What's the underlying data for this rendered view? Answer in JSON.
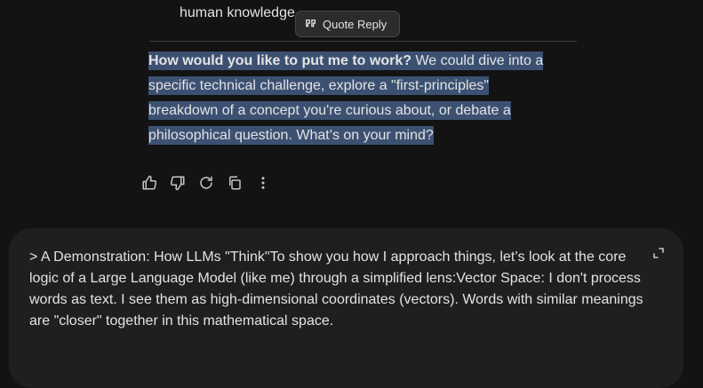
{
  "previous": {
    "line": "human knowledge"
  },
  "quote_reply": {
    "label": "Quote Reply"
  },
  "answer": {
    "bold": "How would you like to put me to work?",
    "rest": " We could dive into a specific technical challenge, explore a \"first-principles\" breakdown of a concept you're curious about, or debate a philosophical question. What’s on your mind?"
  },
  "actions": [
    "thumbs-up-icon",
    "thumbs-down-icon",
    "regenerate-icon",
    "copy-icon",
    "more-vert-icon"
  ],
  "prompt": {
    "text": "> A Demonstration: How LLMs \"Think\"To show you how I approach things, let’s look at the core logic of a Large Language Model (like me) through a simplified lens:Vector Space: I don't process words as text. I see them as high-dimensional coordinates (vectors). Words with similar meanings are \"closer\" together in this mathematical space."
  },
  "colors": {
    "background": "#131314",
    "selection": "#3c5172",
    "input_surface": "#1e1f20"
  }
}
